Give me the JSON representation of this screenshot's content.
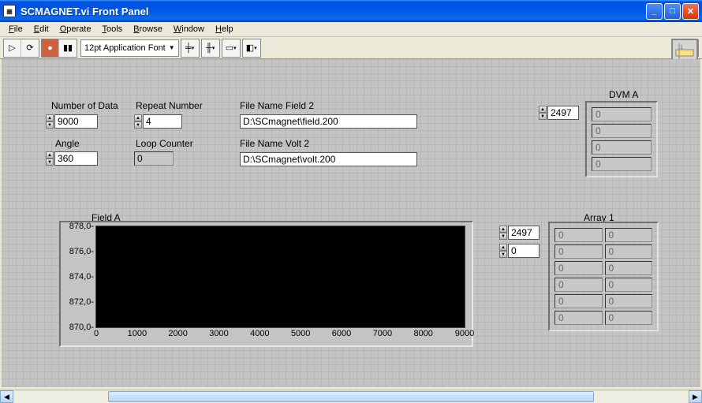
{
  "window": {
    "title": "SCMAGNET.vi Front Panel"
  },
  "menu": {
    "file": "File",
    "edit": "Edit",
    "operate": "Operate",
    "tools": "Tools",
    "browse": "Browse",
    "window": "Window",
    "help": "Help"
  },
  "toolbar": {
    "font": "12pt Application Font"
  },
  "labels": {
    "number_of_data": "Number of Data",
    "repeat_number": "Repeat Number",
    "angle": "Angle",
    "loop_counter": "Loop Counter",
    "file_name_field": "File Name Field  2",
    "file_name_volt": "File Name Volt 2",
    "dvm_a": "DVM A",
    "field_a": "Field A",
    "array1": "Array 1"
  },
  "controls": {
    "number_of_data": "9000",
    "repeat_number": "4",
    "angle": "360",
    "loop_counter": "0",
    "file_field": "D:\\SCmagnet\\field.200",
    "file_volt": "D:\\SCmagnet\\volt.200",
    "dvm_index": "2497",
    "array1_idx1": "2497",
    "array1_idx2": "0"
  },
  "dvm_a": [
    "0",
    "0",
    "0",
    "0"
  ],
  "array1": [
    [
      "0",
      "0"
    ],
    [
      "0",
      "0"
    ],
    [
      "0",
      "0"
    ],
    [
      "0",
      "0"
    ],
    [
      "0",
      "0"
    ],
    [
      "0",
      "0"
    ]
  ],
  "chart_data": {
    "type": "line",
    "title": "Field A",
    "xlabel": "",
    "ylabel": "",
    "xlim": [
      0,
      9000
    ],
    "ylim": [
      870.0,
      878.0
    ],
    "xticks": [
      0,
      1000,
      2000,
      3000,
      4000,
      5000,
      6000,
      7000,
      8000,
      9000
    ],
    "yticks": [
      870.0,
      872.0,
      874.0,
      876.0,
      878.0
    ],
    "series": [
      {
        "name": "Field A",
        "values": []
      }
    ]
  }
}
